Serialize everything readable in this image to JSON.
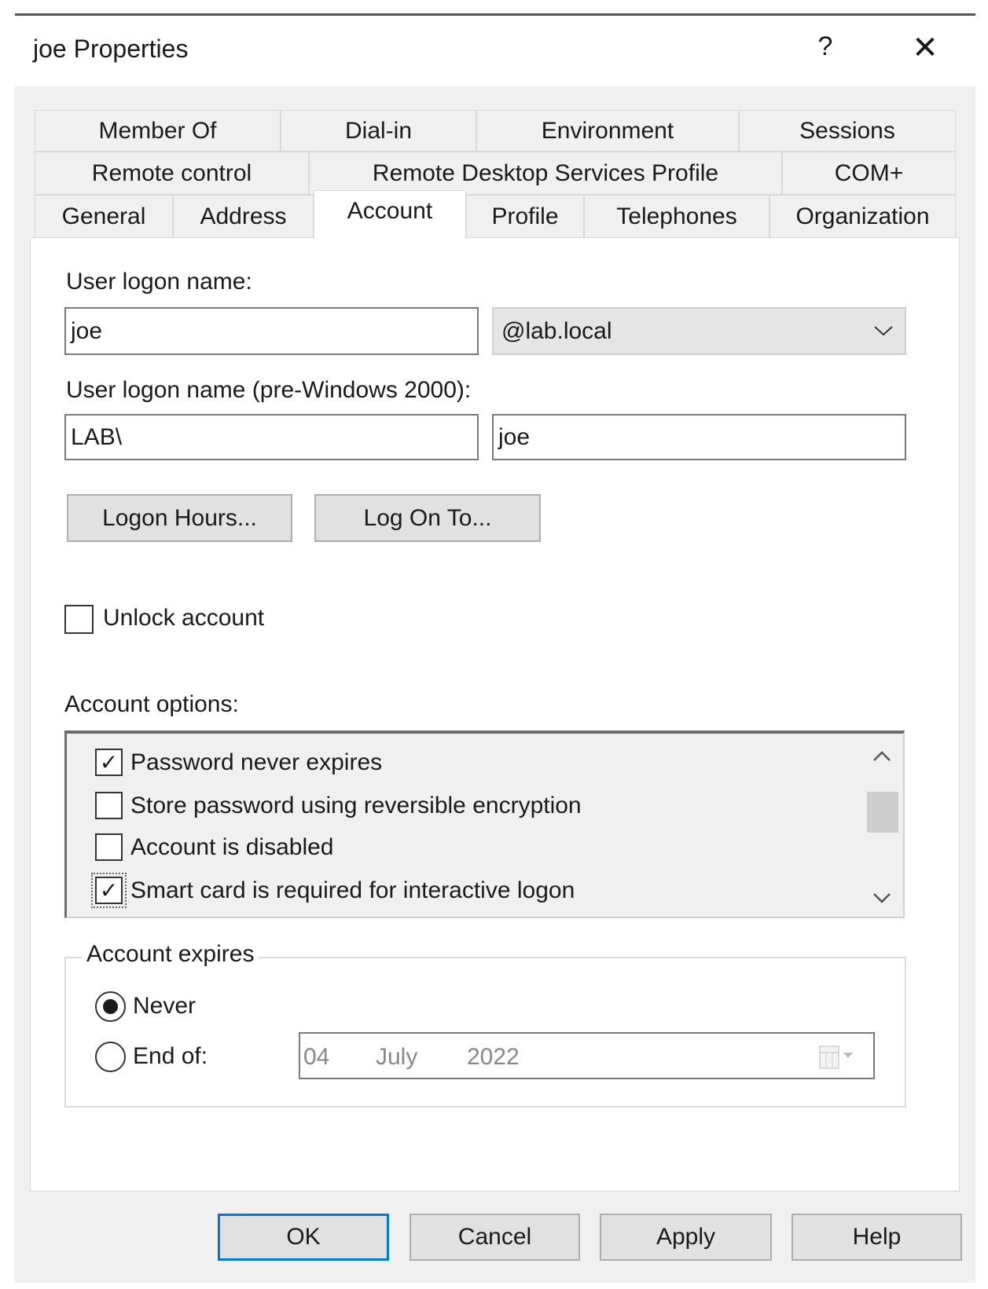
{
  "window": {
    "title": "joe Properties",
    "help_label": "?",
    "close_label": "✕"
  },
  "tabs": {
    "row1": [
      "Member Of",
      "Dial-in",
      "Environment",
      "Sessions"
    ],
    "row2": [
      "Remote control",
      "Remote Desktop Services Profile",
      "COM+"
    ],
    "row3": [
      "General",
      "Address",
      "Account",
      "Profile",
      "Telephones",
      "Organization"
    ],
    "active": "Account"
  },
  "account": {
    "logon_name_label": "User logon name:",
    "logon_name_value": "joe",
    "domain_value": "@lab.local",
    "pre2000_label": "User logon name (pre-Windows 2000):",
    "pre2000_domain": "LAB\\",
    "pre2000_name": "joe",
    "logon_hours_button": "Logon Hours...",
    "log_on_to_button": "Log On To...",
    "unlock_label": "Unlock account",
    "unlock_checked": false,
    "options_label": "Account options:",
    "options": [
      {
        "label": "Password never expires",
        "checked": true
      },
      {
        "label": "Store password using reversible encryption",
        "checked": false
      },
      {
        "label": "Account is disabled",
        "checked": false
      },
      {
        "label": "Smart card is required for interactive logon",
        "checked": true
      }
    ],
    "expires": {
      "legend": "Account expires",
      "never_label": "Never",
      "end_of_label": "End of:",
      "selected": "Never",
      "date": {
        "day": "04",
        "month": "July",
        "year": "2022"
      }
    }
  },
  "footer": {
    "ok": "OK",
    "cancel": "Cancel",
    "apply": "Apply",
    "help": "Help"
  },
  "colors": {
    "accent": "#0078d7",
    "dialog_bg": "#f0f0f0"
  }
}
